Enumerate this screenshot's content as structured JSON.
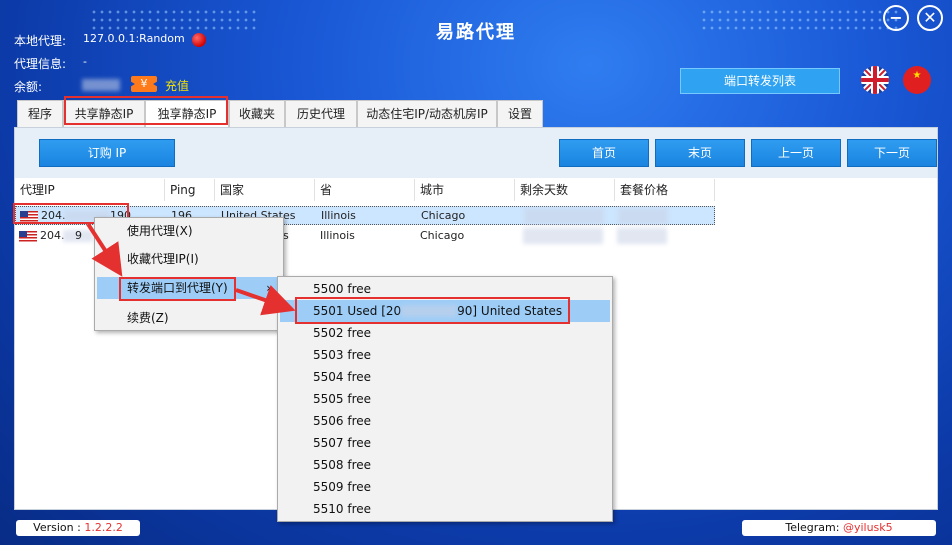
{
  "window": {
    "title": "易路代理",
    "minimize_glyph": "−",
    "close_glyph": "✕"
  },
  "info": {
    "local_proxy_label": "本地代理:",
    "local_proxy_value": "127.0.0.1:Random",
    "proxy_info_label": "代理信息:",
    "proxy_info_value": "-",
    "balance_label": "余额:",
    "coin_glyph": "¥",
    "recharge_label": "充值"
  },
  "port_forward_list_label": "端口转发列表",
  "cn_flag_glyph": "★",
  "tabs": [
    "程序",
    "共享静态IP",
    "独享静态IP",
    "收藏夹",
    "历史代理",
    "动态住宅IP/动态机房IP",
    "设置"
  ],
  "toolbar": {
    "buy_label": "订购 IP",
    "first_label": "首页",
    "last_label": "末页",
    "prev_label": "上一页",
    "next_label": "下一页"
  },
  "table": {
    "columns": [
      "代理IP",
      "Ping",
      "国家",
      "省",
      "城市",
      "剩余天数",
      "套餐价格"
    ],
    "rows": [
      {
        "ip_start": "204.",
        "ip_end": "190",
        "ping": "196",
        "country": "United States",
        "province": "Illinois",
        "city": "Chicago"
      },
      {
        "ip_start": "204.",
        "ip_end": "9",
        "ping": "",
        "country": "s",
        "province": "Illinois",
        "city": "Chicago"
      }
    ]
  },
  "context_menu": {
    "items": [
      "使用代理(X)",
      "收藏代理IP(I)",
      "转发端口到代理(Y)",
      "续费(Z)"
    ],
    "submenu_arrow": "›"
  },
  "submenu": {
    "items": [
      {
        "start": "5500 free",
        "end": ""
      },
      {
        "start": "5501 Used [20",
        "end": "90] United States"
      },
      {
        "start": "5502 free",
        "end": ""
      },
      {
        "start": "5503 free",
        "end": ""
      },
      {
        "start": "5504 free",
        "end": ""
      },
      {
        "start": "5505 free",
        "end": ""
      },
      {
        "start": "5506 free",
        "end": ""
      },
      {
        "start": "5507 free",
        "end": ""
      },
      {
        "start": "5508 free",
        "end": ""
      },
      {
        "start": "5509 free",
        "end": ""
      },
      {
        "start": "5510 free",
        "end": ""
      }
    ]
  },
  "footer": {
    "version_label": "Version : ",
    "version_value": "1.2.2.2",
    "telegram_label": "Telegram: ",
    "telegram_value": "@yilusk5"
  },
  "colors": {
    "accent": "#1a84e0",
    "highlight": "#e53030",
    "recharge": "#f5e200"
  }
}
